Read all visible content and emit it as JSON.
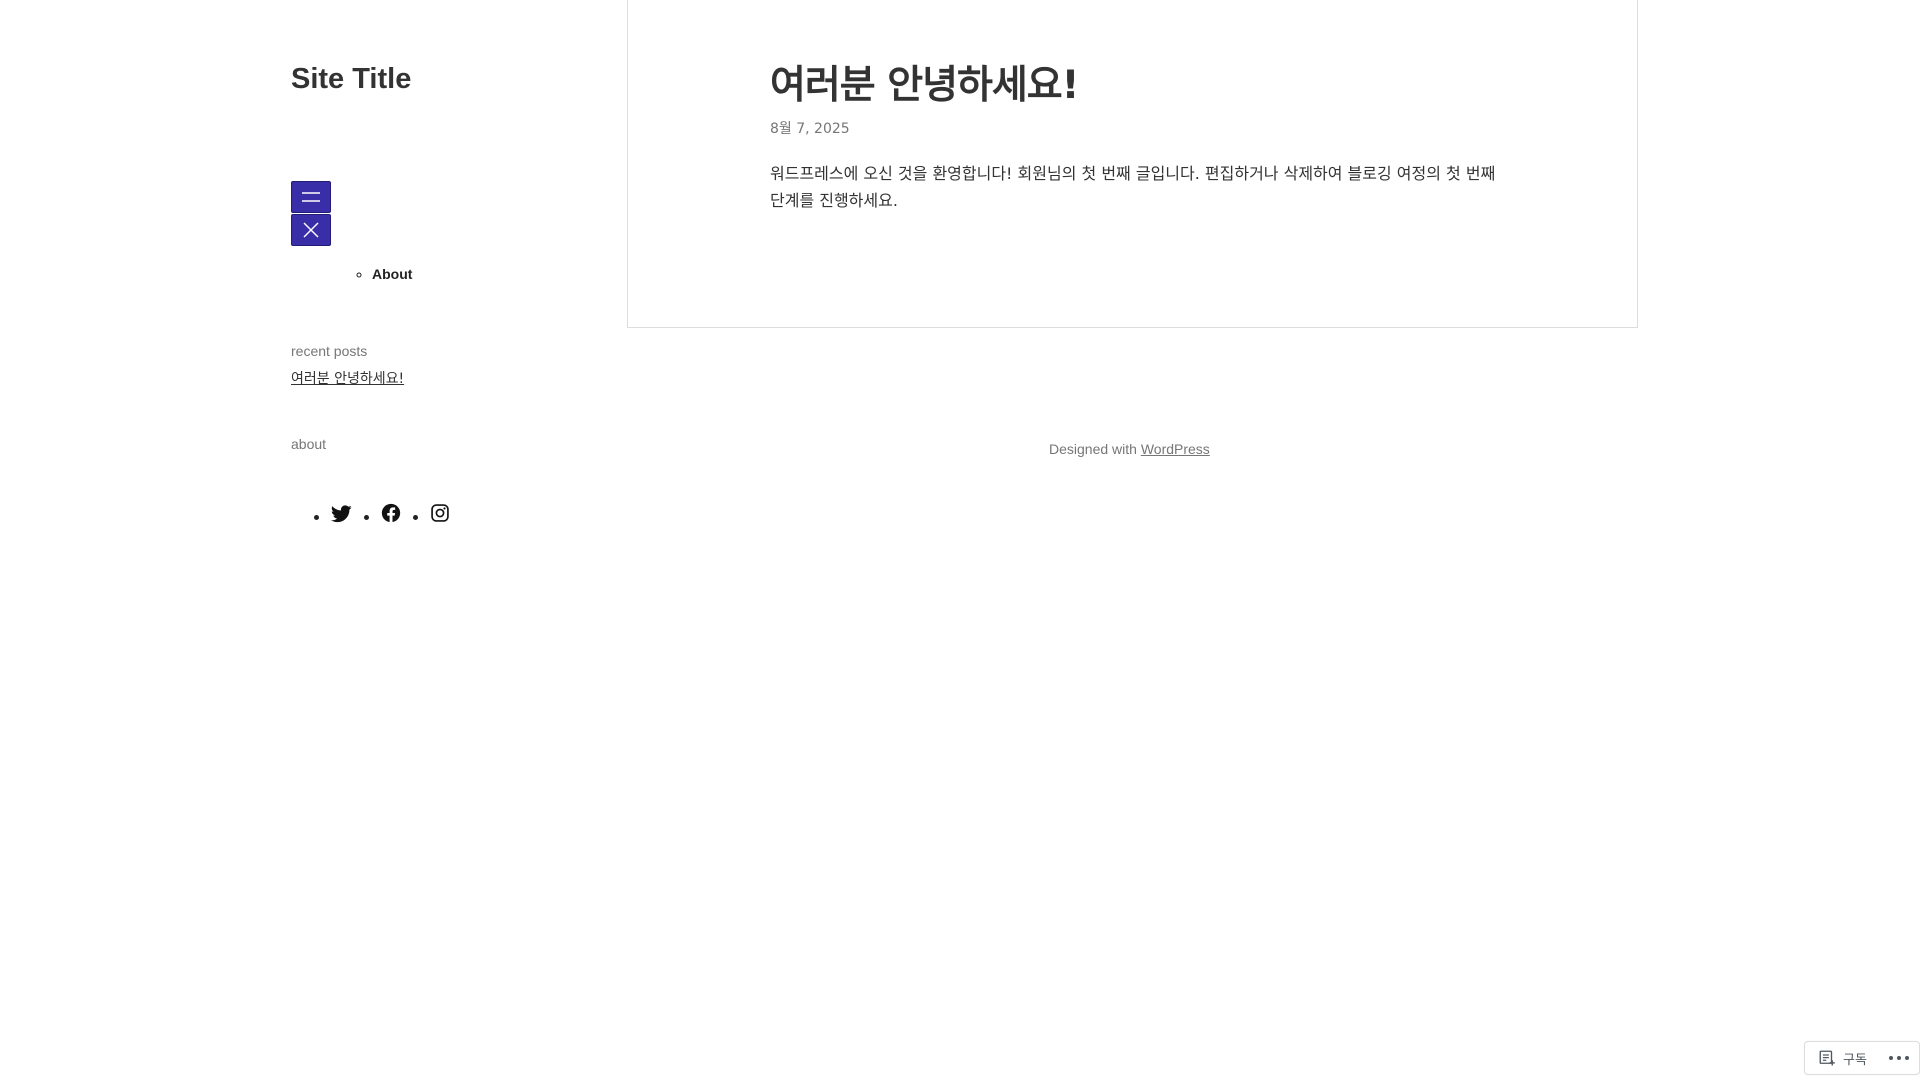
{
  "site": {
    "title": "Site Title"
  },
  "navigation": {
    "items": [
      {
        "label": "About"
      }
    ]
  },
  "widgets": {
    "recent_posts": {
      "title": "recent posts",
      "items": [
        {
          "label": "여러분 안녕하세요!"
        }
      ]
    },
    "about": {
      "title": "about"
    },
    "social_icons": [
      "twitter-icon",
      "facebook-icon",
      "instagram-icon"
    ]
  },
  "post": {
    "title": "여러분 안녕하세요!",
    "date": "8월 7, 2025",
    "body": "워드프레스에 오신 것을 환영합니다! 회원님의 첫 번째 글입니다. 편집하거나 삭제하여 블로깅 여정의 첫 번째 단계를 진행하세요."
  },
  "footer": {
    "prefix": "Designed with ",
    "link_label": "WordPress"
  },
  "subscribe_widget": {
    "label": "구독"
  },
  "colors": {
    "menu_button": "#3a2ea8",
    "text": "#333333",
    "muted": "#767676",
    "border": "#dddddd"
  }
}
